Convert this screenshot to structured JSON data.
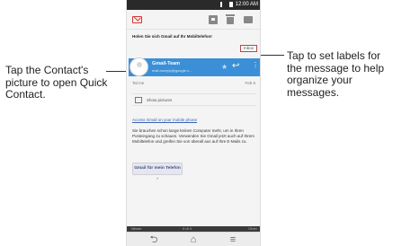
{
  "callouts": {
    "left": "Tap the Contact's picture to open Quick Contact.",
    "right": "Tap to set labels for the message to help organize your messages."
  },
  "status_bar": {
    "time": "12:00 AM"
  },
  "message": {
    "subject": "Holen Sie sich Gmail auf Ihr Mobiltelefon!",
    "label": "Inbox",
    "sender_name": "Gmail-Team",
    "sender_email": "mail-noreply@google.c...",
    "recipient": "Tal me",
    "date": "Feb 6",
    "show_pictures": "Show pictures",
    "access_link": "Access Gmail on your mobile phone",
    "body": "Sie brauchen schon lange keinen Computer mehr, um in Ihren Posteingang zu schauen. Verwenden Sie Gmail jetzt auch auf Ihrem Mobiltelefon und greifen Sie von überall aus auf Ihre E-Mails zu.",
    "cta": "Gmail für mein Telefon ›"
  },
  "pager": {
    "older": "Newer",
    "count": "4 of 4",
    "newer": "Older"
  },
  "icons": {
    "back": "back-icon",
    "home": "home-icon",
    "menu": "menu-icon",
    "reply": "reply-icon",
    "star": "star-icon"
  },
  "colors": {
    "sender_bar": "#3b8fd6",
    "label_border": "#bb4444"
  }
}
